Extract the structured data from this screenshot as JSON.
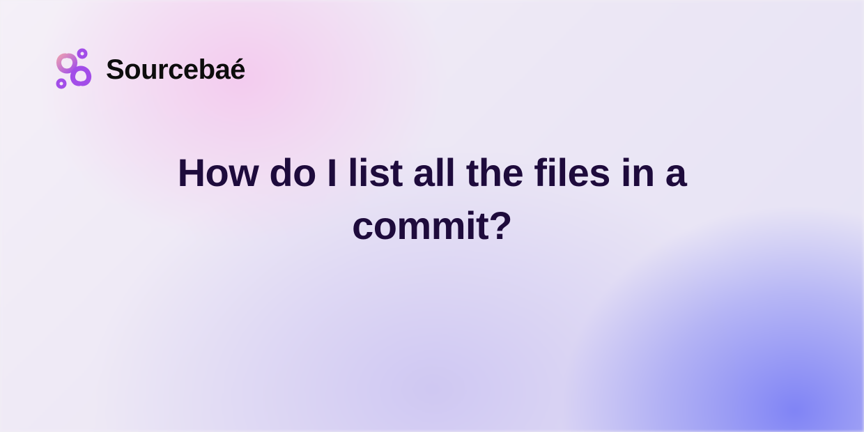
{
  "brand": {
    "name": "Sourcebaé",
    "colors": {
      "logo_pink": "#e89bb5",
      "logo_purple": "#a24de8",
      "text": "#0d0d0d"
    }
  },
  "headline": "How do I list all the files in a commit?",
  "theme": {
    "headline_color": "#1e0b3c",
    "bg_pink": "#f4c8ee",
    "bg_purple": "#6e73f5",
    "bg_base": "#f2eff5"
  }
}
